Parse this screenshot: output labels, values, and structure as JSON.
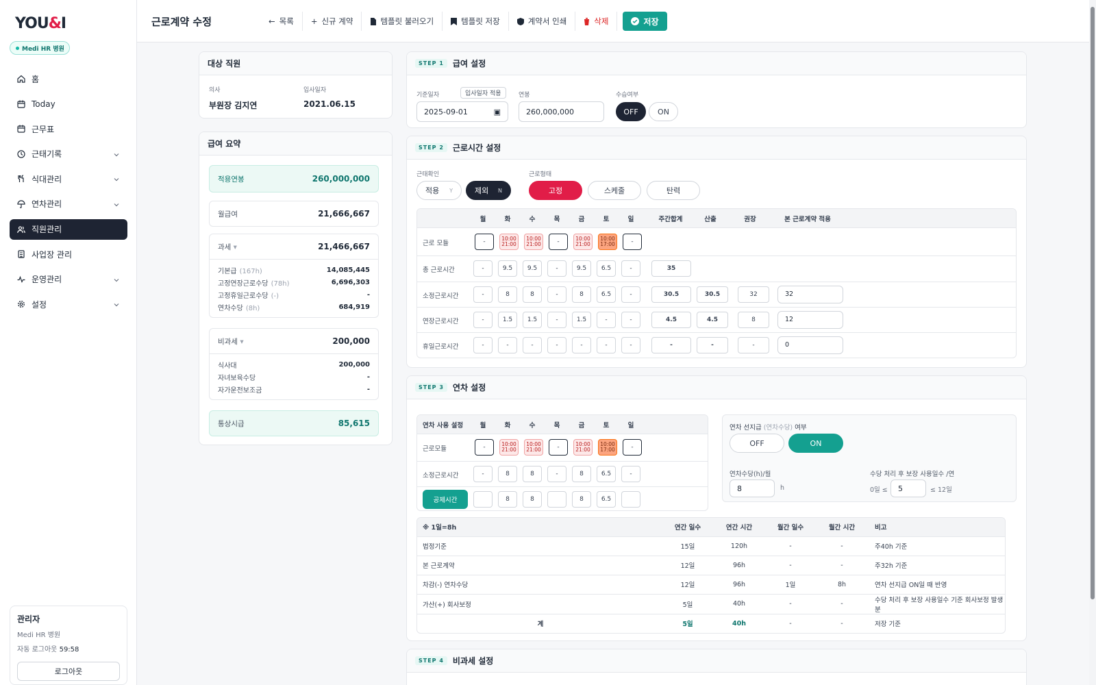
{
  "app": {
    "logo_main": "YOU",
    "logo_amp": "&",
    "logo_tail": "I",
    "org": "Medi HR 병원"
  },
  "nav": [
    {
      "label": "홈",
      "icon": "home-icon",
      "chevron": false,
      "active": false
    },
    {
      "label": "Today",
      "icon": "calendar-icon",
      "chevron": false,
      "active": false
    },
    {
      "label": "근무표",
      "icon": "calendar-icon",
      "chevron": false,
      "active": false
    },
    {
      "label": "근태기록",
      "icon": "clock-icon",
      "chevron": true,
      "active": false
    },
    {
      "label": "식대관리",
      "icon": "utensils-icon",
      "chevron": true,
      "active": false
    },
    {
      "label": "연차관리",
      "icon": "umbrella-icon",
      "chevron": true,
      "active": false
    },
    {
      "label": "직원관리",
      "icon": "users-icon",
      "chevron": false,
      "active": true
    },
    {
      "label": "사업장 관리",
      "icon": "building-icon",
      "chevron": false,
      "active": false
    },
    {
      "label": "운영관리",
      "icon": "activity-icon",
      "chevron": true,
      "active": false
    },
    {
      "label": "설정",
      "icon": "gear-icon",
      "chevron": true,
      "active": false
    }
  ],
  "user": {
    "name": "관리자",
    "org": "Medi HR 병원",
    "auto_logout_label": "자동 로그아웃",
    "auto_logout_time": "59:58",
    "logout": "로그아웃"
  },
  "topbar": {
    "title": "근로계약 수정",
    "actions": {
      "list": "목록",
      "new": "신규 계약",
      "load_tpl": "템플릿 불러오기",
      "save_tpl": "템플릿 저장",
      "print": "계약서 인쇄",
      "delete": "삭제",
      "save": "저장"
    }
  },
  "employee": {
    "header": "대상 직원",
    "role_label": "의사",
    "name": "부원장 김지연",
    "hire_label": "입사일자",
    "hire_date": "2021.06.15"
  },
  "summary": {
    "header": "급여 요약",
    "applied_label": "적용연봉",
    "applied": "260,000,000",
    "monthly_label": "월급여",
    "monthly": "21,666,667",
    "taxable_label": "과세",
    "taxable": "21,466,667",
    "taxable_rows": [
      {
        "label": "기본급",
        "hint": "(167h)",
        "value": "14,085,445"
      },
      {
        "label": "고정연장근로수당",
        "hint": "(78h)",
        "value": "6,696,303"
      },
      {
        "label": "고정휴일근로수당",
        "hint": "(-)",
        "value": "-"
      },
      {
        "label": "연차수당",
        "hint": "(8h)",
        "value": "684,919"
      }
    ],
    "nontax_label": "비과세",
    "nontax": "200,000",
    "nontax_rows": [
      {
        "label": "식사대",
        "value": "200,000"
      },
      {
        "label": "자녀보육수당",
        "value": "-"
      },
      {
        "label": "자가운전보조금",
        "value": "-"
      }
    ],
    "hourly_label": "통상시급",
    "hourly": "85,615"
  },
  "step1": {
    "badge": "STEP 1",
    "title": "급여 설정",
    "base_date_label": "기준일자",
    "apply_hire_btn": "입사일자 적용",
    "base_date": "2025-09-01",
    "salary_label": "연봉",
    "salary": "260,000,000",
    "probation_label": "수습여부",
    "off": "OFF",
    "on": "ON"
  },
  "step2": {
    "badge": "STEP 2",
    "title": "근로시간 설정",
    "attendance_label": "근태확인",
    "apply": "적용",
    "apply_key": "Y",
    "exclude": "제외",
    "exclude_key": "N",
    "type_label": "근로형태",
    "types": [
      "고정",
      "스케줄",
      "탄력"
    ],
    "days": [
      "월",
      "화",
      "수",
      "목",
      "금",
      "토",
      "일"
    ],
    "extra_cols": [
      "주간합계",
      "산출",
      "권장",
      "본 근로계약 적용"
    ],
    "rows": [
      {
        "label": "근로 모듈",
        "cells": [
          "-",
          "10:00|21:00",
          "10:00|21:00",
          "-",
          "10:00|21:00",
          "10:00|17:00",
          "-"
        ]
      },
      {
        "label": "총 근로시간",
        "cells": [
          "-",
          "9.5",
          "9.5",
          "-",
          "9.5",
          "6.5",
          "-"
        ],
        "total": "35"
      },
      {
        "label": "소정근로시간",
        "cells": [
          "-",
          "8",
          "8",
          "-",
          "8",
          "6.5",
          "-"
        ],
        "total": "30.5",
        "calc": "30.5",
        "rec": "32",
        "apply": "32"
      },
      {
        "label": "연장근로시간",
        "cells": [
          "-",
          "1.5",
          "1.5",
          "-",
          "1.5",
          "-",
          "-"
        ],
        "total": "4.5",
        "calc": "4.5",
        "rec": "8",
        "apply": "12"
      },
      {
        "label": "휴일근로시간",
        "cells": [
          "-",
          "-",
          "-",
          "-",
          "-",
          "-",
          "-"
        ],
        "total": "-",
        "calc": "-",
        "rec": "-",
        "apply": "0"
      }
    ]
  },
  "step3": {
    "badge": "STEP 3",
    "title": "연차 설정",
    "grid_header": "연차 사용 설정",
    "module_label": "근로모듈",
    "module_cells": [
      "-",
      "10:00|21:00",
      "10:00|21:00",
      "-",
      "10:00|21:00",
      "10:00|17:00",
      "-"
    ],
    "work_label": "소정근로시간",
    "work_cells": [
      "-",
      "8",
      "8",
      "-",
      "8",
      "6.5",
      "-"
    ],
    "deduct_btn": "공제시간",
    "deduct_cells": [
      "",
      "8",
      "8",
      "",
      "8",
      "6.5",
      ""
    ],
    "advance_label": "연차 선지급",
    "advance_hint": "(연차수당)",
    "advance_tail": "여부",
    "off": "OFF",
    "on": "ON",
    "hours_label": "연차수당(h)/월",
    "hours_value": "8",
    "hours_unit": "h",
    "guarantee_label": "수당 처리 후 보장 사용일수 /연",
    "guarantee_min": "0일 ≤",
    "guarantee_value": "5",
    "guarantee_max": "≤ 12일",
    "table": {
      "headers": [
        "※ 1일=8h",
        "연간 일수",
        "연간 시간",
        "월간 일수",
        "월간 시간",
        "비고"
      ],
      "rows": [
        [
          "법정기준",
          "15일",
          "120h",
          "-",
          "-",
          "주40h 기준"
        ],
        [
          "본 근로계약",
          "12일",
          "96h",
          "-",
          "-",
          "주32h 기준"
        ],
        [
          "차감(-) 연차수당",
          "12일",
          "96h",
          "1일",
          "8h",
          "연차 선지급 ON일 때 반영"
        ],
        [
          "가산(+) 회사보정",
          "5일",
          "40h",
          "-",
          "-",
          "수당 처리 후 보장 사용일수 기준 회사보정 발생분"
        ]
      ],
      "total": [
        "계",
        "5일",
        "40h",
        "-",
        "-",
        "저장 기준"
      ]
    }
  },
  "step4": {
    "badge": "STEP 4",
    "title": "비과세 설정"
  }
}
